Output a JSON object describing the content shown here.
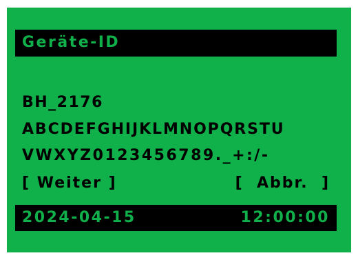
{
  "colors": {
    "screen_bg": "#10b04a",
    "bar_bg": "#000000",
    "text": "#000000",
    "bar_text": "#10b04a"
  },
  "header": {
    "title": "Geräte-ID"
  },
  "id_field": {
    "value": "BH_2176"
  },
  "charset": {
    "row1": "ABCDEFGHIJKLMNOPQRSTU",
    "row2": "VWXYZ0123456789._+:/-"
  },
  "buttons": {
    "next_label": "[ Weiter ]",
    "abort_label": "[  Abbr.  ]"
  },
  "status": {
    "date": "2024-04-15",
    "time": "12:00:00"
  }
}
